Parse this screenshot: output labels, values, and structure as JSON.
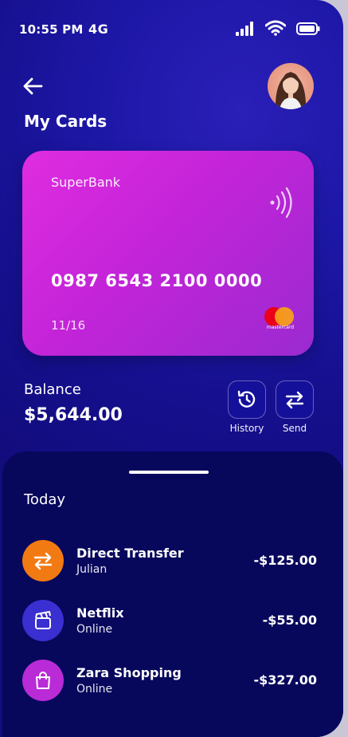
{
  "status_bar": {
    "time": "10:55 PM",
    "network": "4G"
  },
  "header": {
    "title": "My Cards"
  },
  "card": {
    "bank": "SuperBank",
    "number": "0987 6543 2100 0000",
    "expiry": "11/16",
    "brand": "mastercard",
    "gradient_colors": [
      "#e02ce0",
      "#9a2ad0"
    ]
  },
  "balance": {
    "label": "Balance",
    "value": "$5,644.00"
  },
  "actions": [
    {
      "label": "History",
      "icon": "history-icon"
    },
    {
      "label": "Send",
      "icon": "transfer-icon"
    }
  ],
  "transactions": {
    "section_title": "Today",
    "items": [
      {
        "title": "Direct Transfer",
        "subtitle": "Julian",
        "amount": "-$125.00",
        "icon": "transfer-icon",
        "color": "#f27a12"
      },
      {
        "title": "Netflix",
        "subtitle": "Online",
        "amount": "-$55.00",
        "icon": "clapperboard-icon",
        "color": "#3a2fd0"
      },
      {
        "title": "Zara Shopping",
        "subtitle": "Online",
        "amount": "-$327.00",
        "icon": "shopping-bag-icon",
        "color": "#b92bd6"
      }
    ]
  },
  "colors": {
    "background": "#1a139e",
    "sheet": "#07075c",
    "card_accent": "#d62ad9"
  }
}
